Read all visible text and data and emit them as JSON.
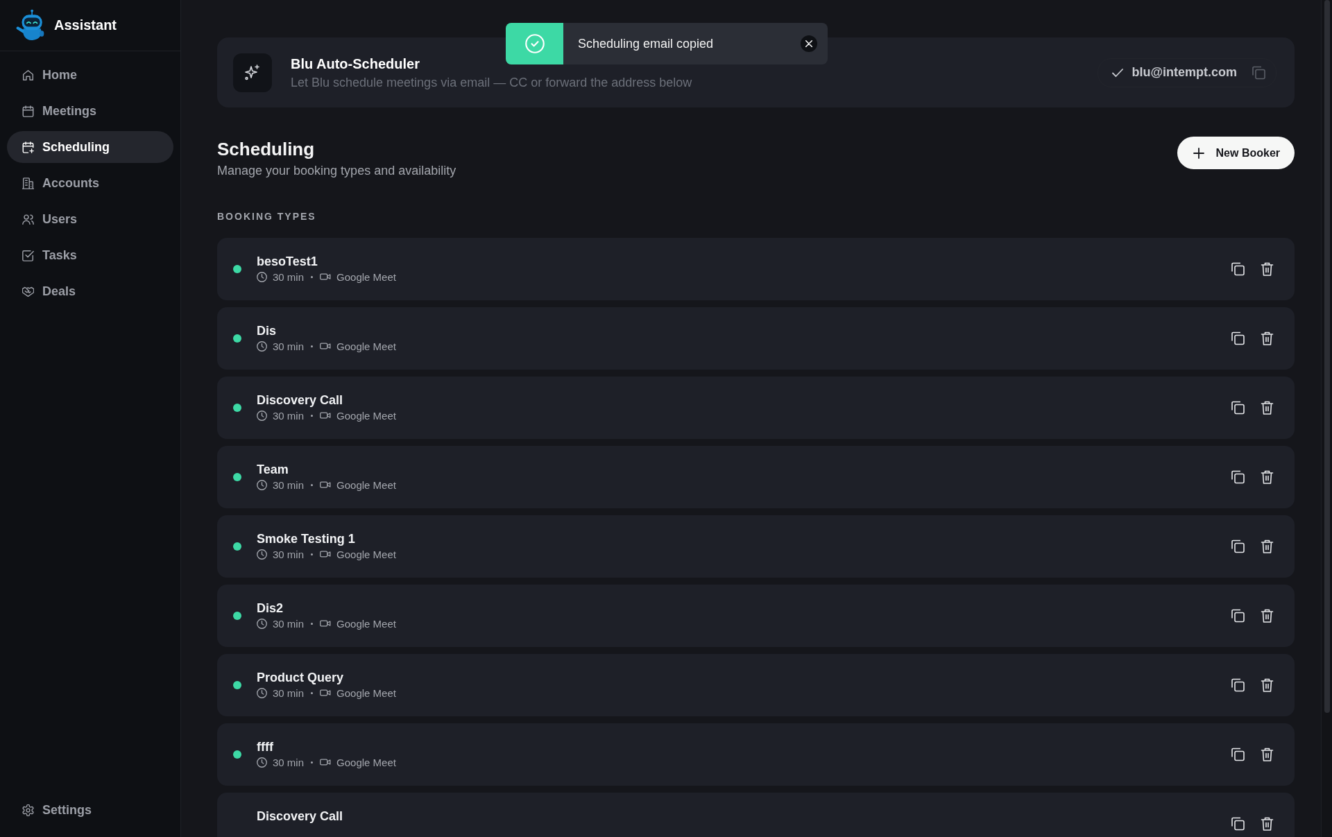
{
  "sidebar": {
    "brand": "Assistant",
    "items": [
      {
        "label": "Home",
        "selected": false
      },
      {
        "label": "Meetings",
        "selected": false
      },
      {
        "label": "Scheduling",
        "selected": true
      },
      {
        "label": "Accounts",
        "selected": false
      },
      {
        "label": "Users",
        "selected": false
      },
      {
        "label": "Tasks",
        "selected": false
      },
      {
        "label": "Deals",
        "selected": false
      }
    ],
    "footer_items": [
      {
        "label": "Settings",
        "selected": false
      }
    ]
  },
  "toast": {
    "kind": "success",
    "message": "Scheduling email copied"
  },
  "auto_scheduler": {
    "title": "Blu Auto-Scheduler",
    "subtitle": "Let Blu schedule meetings via email — CC or forward the address below",
    "email": "blu@intempt.com",
    "verified": true
  },
  "page_header": {
    "title": "Scheduling",
    "subtitle": "Manage your booking types and availability",
    "action": "New Booker"
  },
  "booking_types": {
    "heading": "BOOKING TYPES",
    "rows": [
      {
        "name": "besoTest1",
        "active": true,
        "duration": "30 min",
        "platform": "Google Meet"
      },
      {
        "name": "Dis",
        "active": true,
        "duration": "30 min",
        "platform": "Google Meet"
      },
      {
        "name": "Discovery Call",
        "active": true,
        "duration": "30 min",
        "platform": "Google Meet"
      },
      {
        "name": "Team",
        "active": true,
        "duration": "30 min",
        "platform": "Google Meet"
      },
      {
        "name": "Smoke Testing 1",
        "active": true,
        "duration": "30 min",
        "platform": "Google Meet"
      },
      {
        "name": "Dis2",
        "active": true,
        "duration": "30 min",
        "platform": "Google Meet"
      },
      {
        "name": "Product Query",
        "active": true,
        "duration": "30 min",
        "platform": "Google Meet"
      },
      {
        "name": "ffff",
        "active": true,
        "duration": "30 min",
        "platform": "Google Meet"
      },
      {
        "name": "Discovery Call"
      }
    ]
  }
}
